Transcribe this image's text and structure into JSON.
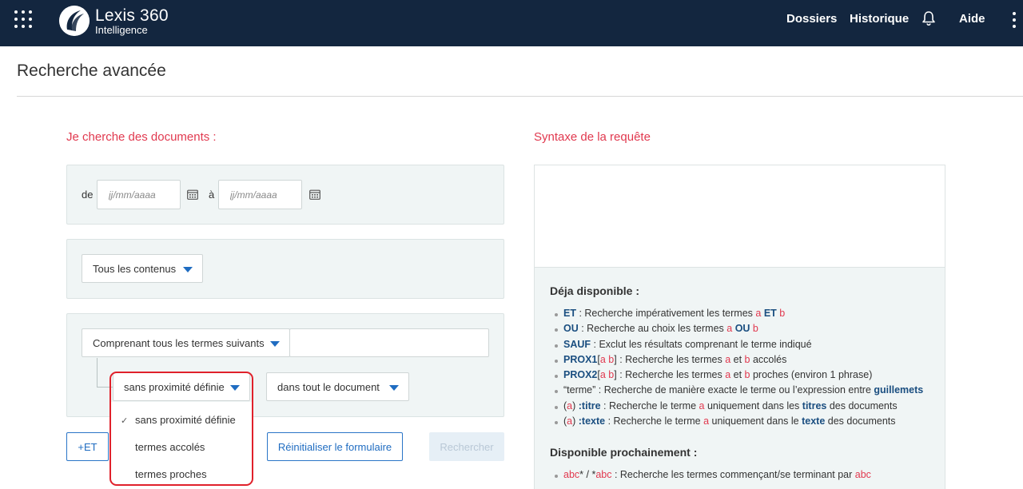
{
  "header": {
    "logo_title": "Lexis 360",
    "logo_sub": "Intelligence",
    "nav": {
      "dossiers": "Dossiers",
      "historique": "Historique",
      "aide": "Aide"
    }
  },
  "page": {
    "title": "Recherche avancée"
  },
  "form": {
    "heading": "Je cherche des documents :",
    "date_from_label": "de",
    "date_to_label": "à",
    "date_placeholder": "jj/mm/aaaa",
    "content_select": "Tous les contenus",
    "terms_select": "Comprenant tous les termes suivants",
    "proximity_select": "sans proximité définie",
    "scope_select": "dans tout le document",
    "proximity_options": [
      {
        "label": "sans proximité définie",
        "check": "✓"
      },
      {
        "label": "termes accolés"
      },
      {
        "label": "termes proches"
      }
    ],
    "buttons": {
      "add_et": "+ET",
      "reset": "Réinitialiser le formulaire",
      "search": "Rechercher"
    }
  },
  "syntax": {
    "heading": "Syntaxe de la requête",
    "available_heading": "Déja disponible :",
    "available": [
      [
        {
          "k": "ET"
        },
        {
          "t": " : Recherche impérativement les termes "
        },
        {
          "v": "a"
        },
        {
          "t": " "
        },
        {
          "k": "ET"
        },
        {
          "t": " "
        },
        {
          "v": "b"
        }
      ],
      [
        {
          "k": "OU"
        },
        {
          "t": " : Recherche au choix les termes "
        },
        {
          "v": "a"
        },
        {
          "t": " "
        },
        {
          "k": "OU"
        },
        {
          "t": " "
        },
        {
          "v": "b"
        }
      ],
      [
        {
          "k": "SAUF"
        },
        {
          "t": " : Exclut les résultats comprenant le terme indiqué"
        }
      ],
      [
        {
          "k": "PROX1"
        },
        {
          "t": "["
        },
        {
          "v": "a b"
        },
        {
          "t": "] : Recherche les termes "
        },
        {
          "v": "a"
        },
        {
          "t": " et "
        },
        {
          "v": "b"
        },
        {
          "t": " accolés"
        }
      ],
      [
        {
          "k": "PROX2"
        },
        {
          "t": "["
        },
        {
          "v": "a b"
        },
        {
          "t": "] : Recherche les termes "
        },
        {
          "v": "a"
        },
        {
          "t": " et "
        },
        {
          "v": "b"
        },
        {
          "t": " proches (environ 1 phrase)"
        }
      ],
      [
        {
          "t": "“terme” : Recherche de manière exacte le terme ou l’expression entre "
        },
        {
          "k": "guillemets"
        }
      ],
      [
        {
          "t": "("
        },
        {
          "v": "a"
        },
        {
          "t": ") "
        },
        {
          "k": ":titre"
        },
        {
          "t": " : Recherche le terme "
        },
        {
          "v": "a"
        },
        {
          "t": " uniquement dans les "
        },
        {
          "k": "titres"
        },
        {
          "t": " des documents"
        }
      ],
      [
        {
          "t": "("
        },
        {
          "v": "a"
        },
        {
          "t": ") "
        },
        {
          "k": ":texte"
        },
        {
          "t": " : Recherche le terme "
        },
        {
          "v": "a"
        },
        {
          "t": " uniquement dans le "
        },
        {
          "k": "texte"
        },
        {
          "t": " des documents"
        }
      ]
    ],
    "upcoming_heading": "Disponible prochainement :",
    "upcoming": [
      [
        {
          "v": "abc"
        },
        {
          "t": "* / *"
        },
        {
          "v": "abc"
        },
        {
          "t": " : Recherche les termes commençant/se terminant par "
        },
        {
          "v": "abc"
        }
      ]
    ]
  },
  "colors": {
    "header_bg": "#13263f",
    "accent_red": "#e1394f",
    "link_blue": "#1f6cc1",
    "keyword_blue": "#1a4e80"
  }
}
